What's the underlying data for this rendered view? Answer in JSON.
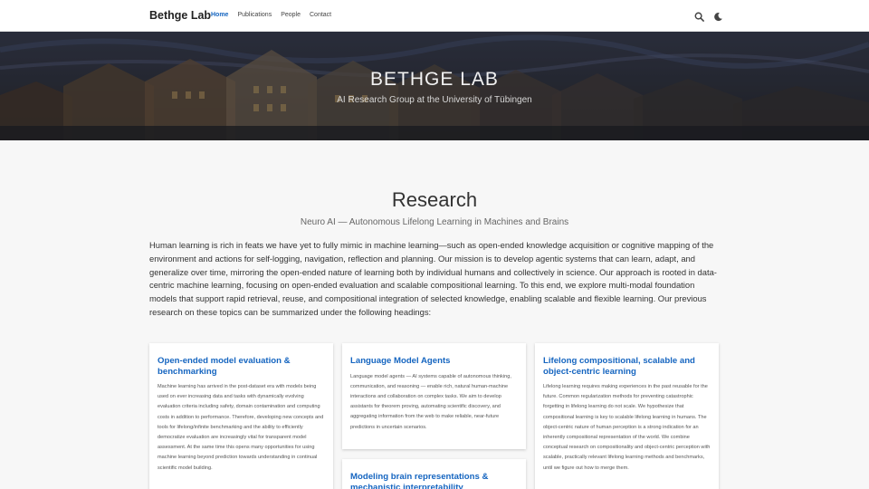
{
  "nav": {
    "brand": "Bethge Lab",
    "links": [
      "Home",
      "Publications",
      "People",
      "Contact"
    ],
    "active": "Home",
    "icons": [
      "search-icon",
      "moon-icon"
    ]
  },
  "hero": {
    "title": "BETHGE LAB",
    "subtitle": "AI Research Group at the University of Tübingen"
  },
  "research": {
    "title": "Research",
    "subtitle": "Neuro AI — Autonomous Lifelong Learning in Machines and Brains",
    "intro": "Human learning is rich in feats we have yet to fully mimic in machine learning—such as open-ended knowledge acquisition or cognitive mapping of the environment and actions for self-logging, navigation, reflection and planning. Our mission is to develop agentic systems that can learn, adapt, and generalize over time, mirroring the open-ended nature of learning both by individual humans and collectively in science. Our approach is rooted in data-centric machine learning, focusing on open-ended evaluation and scalable compositional learning. To this end, we explore multi-modal foundation models that support rapid retrieval, reuse, and compositional integration of selected knowledge, enabling scalable and flexible learning. Our previous research on these topics can be summarized under the following headings:",
    "cards": [
      {
        "title": "Open-ended model evaluation & benchmarking",
        "text": "Machine learning has arrived in the post-dataset era with models being used on ever increasing data and tasks with dynamically evolving evaluation criteria including safety, domain contamination and computing costs in addition to performance. Therefore, developing new concepts and tools for lifelong/infinite benchmarking and the ability to efficiently democratize evaluation are increasingly vital for transparent model assessment. At the same time this opens many opportunities for using machine learning beyond prediction towards understanding in continual scientific model building."
      },
      {
        "title": "Language Model Agents",
        "text": "Language model agents — AI systems capable of autonomous thinking, communication, and reasoning — enable rich, natural human-machine interactions and collaboration on complex tasks. We aim to develop assistants for theorem proving, automating scientific discovery, and aggregating information from the web to make reliable, near-future predictions in uncertain scenarios."
      },
      {
        "title": "Lifelong compositional, scalable and object-centric learning",
        "text": "Lifelong learning requires making experiences in the past reusable for the future. Common regularization methods for preventing catastrophic forgetting in lifelong learning do not scale. We hypothesize that compositional learning is key to scalable lifelong learning in humans. The object-centric nature of human perception is a strong indication for an inherently compositional representation of the world. We combine conceptual research on compositionality and object-centric perception with scalable, practically relevant lifelong learning methods and benchmarks, until we figure out how to merge them."
      },
      {
        "title": "Modeling brain representations & mechanistic interpretability",
        "text": ""
      }
    ]
  }
}
